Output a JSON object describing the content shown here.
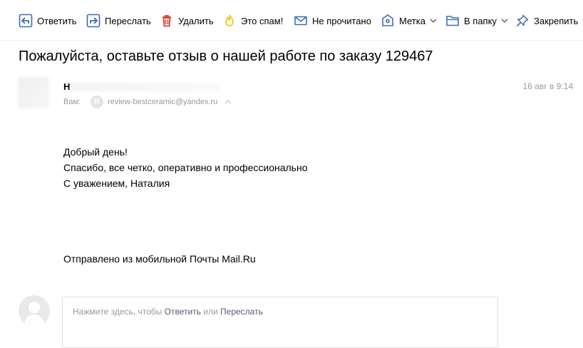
{
  "toolbar": {
    "reply": "Ответить",
    "forward": "Переслать",
    "delete": "Удалить",
    "spam": "Это спам!",
    "unread": "Не прочитано",
    "label": "Метка",
    "to_folder": "В папку",
    "pin": "Закрепить"
  },
  "message": {
    "subject": "Пожалуйста, оставьте отзыв о нашей работе по заказу 129467",
    "sender_initial": "Н",
    "to_label": "Вам:",
    "recipient_badge": "R",
    "recipient_email": "review-bestceramic@yandex.ru",
    "date": "16 авг в 9:14",
    "body_lines": [
      "Добрый день!",
      "Спасибо, все четко, оперативно и профессионально",
      "С уважением, Наталия"
    ],
    "signature": "Отправлено из мобильной Почты Mail.Ru"
  },
  "reply_box": {
    "hint_prefix": "Нажмите здесь, чтобы ",
    "reply_link": "Ответить",
    "or": " или ",
    "forward_link": "Переслать"
  },
  "colors": {
    "icon_blue": "#3d6db5",
    "delete_red": "#e0382c",
    "spam_yellow": "#f5c518",
    "muted_text": "#999999"
  },
  "icons": {
    "reply": "reply-arrow-icon",
    "forward": "forward-arrow-icon",
    "delete": "trash-icon",
    "spam": "flame-icon",
    "unread": "envelope-icon",
    "label": "tag-icon",
    "to_folder": "folder-icon",
    "pin": "pin-icon"
  }
}
